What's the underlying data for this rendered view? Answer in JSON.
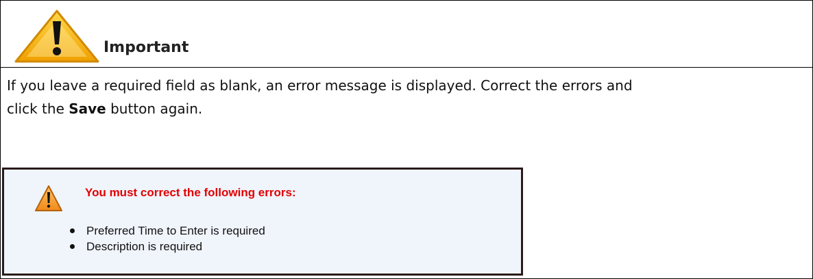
{
  "header": {
    "title": "Important",
    "icon": "warning-icon"
  },
  "message": {
    "line1": "If you leave a required field as blank, an error message is displayed.  Correct the errors and",
    "line2_pre": "click the ",
    "line2_bold": "Save",
    "line2_post": " button again."
  },
  "error_box": {
    "icon": "warning-icon",
    "title": "You must correct the following errors:",
    "title_color": "#e20000",
    "items": [
      "Preferred Time to Enter is required",
      "Description is required"
    ]
  }
}
